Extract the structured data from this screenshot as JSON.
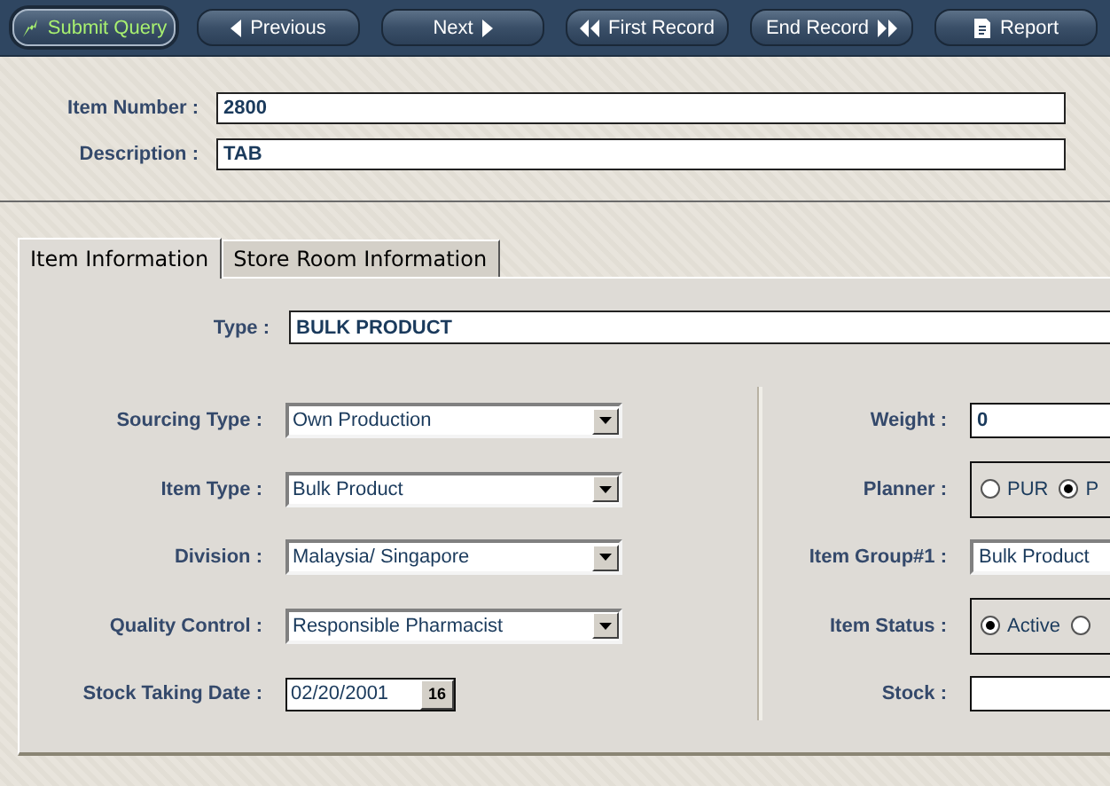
{
  "toolbar": {
    "buttons": [
      {
        "label": "Submit Query",
        "kind": "lightning",
        "default": true
      },
      {
        "label": "Previous",
        "kind": "left",
        "default": false
      },
      {
        "label": "Next",
        "kind": "right",
        "default": false
      },
      {
        "label": "First Record",
        "kind": "first",
        "default": false
      },
      {
        "label": "End Record",
        "kind": "last",
        "default": false
      },
      {
        "label": "Report",
        "kind": "document",
        "default": false
      }
    ]
  },
  "header": {
    "fields": [
      {
        "label": "Item Number :",
        "value": "2800"
      },
      {
        "label": "Description :",
        "value": "TAB"
      }
    ]
  },
  "tabs": [
    {
      "label": "Item Information",
      "selected": true
    },
    {
      "label": "Store Room Information",
      "selected": false
    }
  ],
  "type_field": {
    "label": "Type :",
    "value": "BULK PRODUCT"
  },
  "left_fields": [
    {
      "label": "Sourcing Type :",
      "kind": "select",
      "value": "Own Production"
    },
    {
      "label": "Item Type :",
      "kind": "select",
      "value": "Bulk Product"
    },
    {
      "label": "Division :",
      "kind": "select",
      "value": "Malaysia/ Singapore"
    },
    {
      "label": "Quality Control :",
      "kind": "select",
      "value": "Responsible Pharmacist"
    },
    {
      "label": "Stock Taking Date  :",
      "kind": "date",
      "value": "02/20/2001",
      "button": "16"
    }
  ],
  "right_fields": [
    {
      "label": "Weight :",
      "kind": "text",
      "value": "0"
    },
    {
      "label": "Planner :",
      "kind": "radio",
      "options": [
        {
          "label": "PUR",
          "selected": false
        },
        {
          "label": "P",
          "selected": true
        }
      ]
    },
    {
      "label": "Item Group#1 :",
      "kind": "sunken",
      "value": "Bulk Product"
    },
    {
      "label": "Item Status :",
      "kind": "radio",
      "options": [
        {
          "label": "Active",
          "selected": true
        },
        {
          "selected": false
        }
      ]
    },
    {
      "label": "Stock :",
      "kind": "text"
    }
  ]
}
